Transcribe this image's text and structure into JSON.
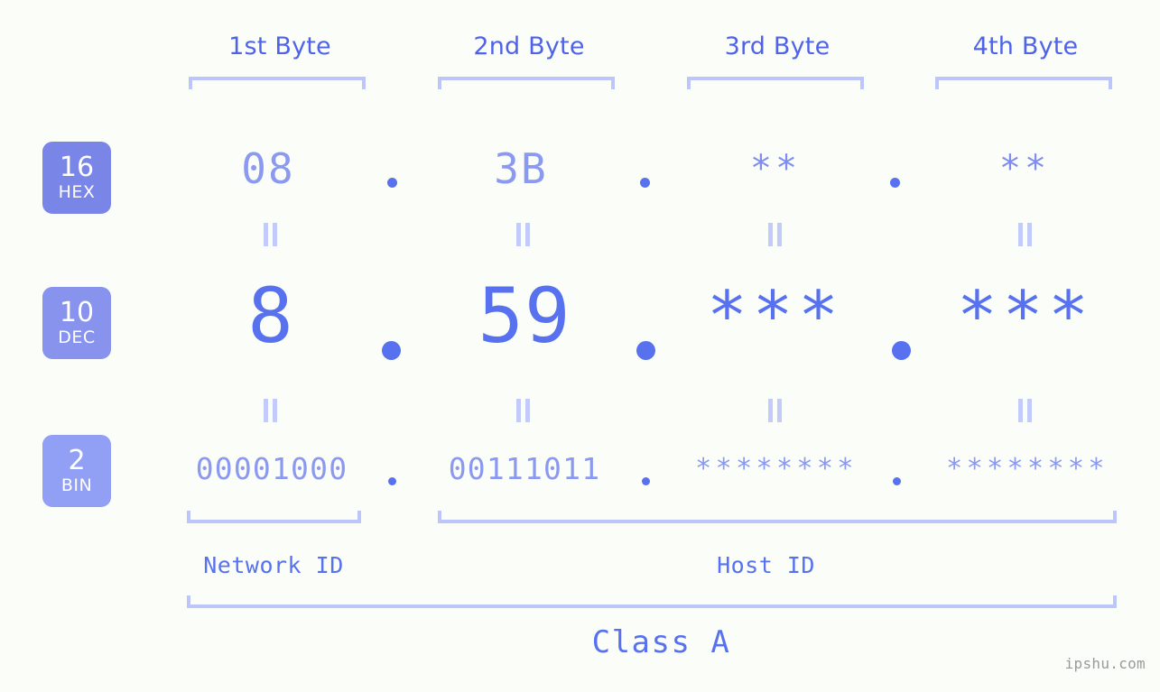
{
  "page": {
    "background_color": "#fbfdf8",
    "accent_color": "#5771ef",
    "light_accent_color": "#8b99f0",
    "bracket_color": "#bcc6fb",
    "watermark": "ipshu.com"
  },
  "byte_headers": [
    {
      "label": "1st Byte"
    },
    {
      "label": "2nd Byte"
    },
    {
      "label": "3rd Byte"
    },
    {
      "label": "4th Byte"
    }
  ],
  "bases": [
    {
      "number": "16",
      "name": "HEX",
      "color": "#7986e8"
    },
    {
      "number": "10",
      "name": "DEC",
      "color": "#8793ec"
    },
    {
      "number": "2",
      "name": "BIN",
      "color": "#91a0f4"
    }
  ],
  "rows": {
    "hex": {
      "values": [
        "08",
        "3B",
        "**",
        "**"
      ]
    },
    "dec": {
      "values": [
        "8",
        "59",
        "***",
        "***"
      ]
    },
    "bin": {
      "values": [
        "00001000",
        "00111011",
        "********",
        "********"
      ]
    }
  },
  "separators": {
    "dot": "."
  },
  "equals_marks": {
    "glyph": "="
  },
  "segments": [
    {
      "label": "Network ID"
    },
    {
      "label": "Host ID"
    }
  ],
  "class": {
    "label": "Class A"
  }
}
